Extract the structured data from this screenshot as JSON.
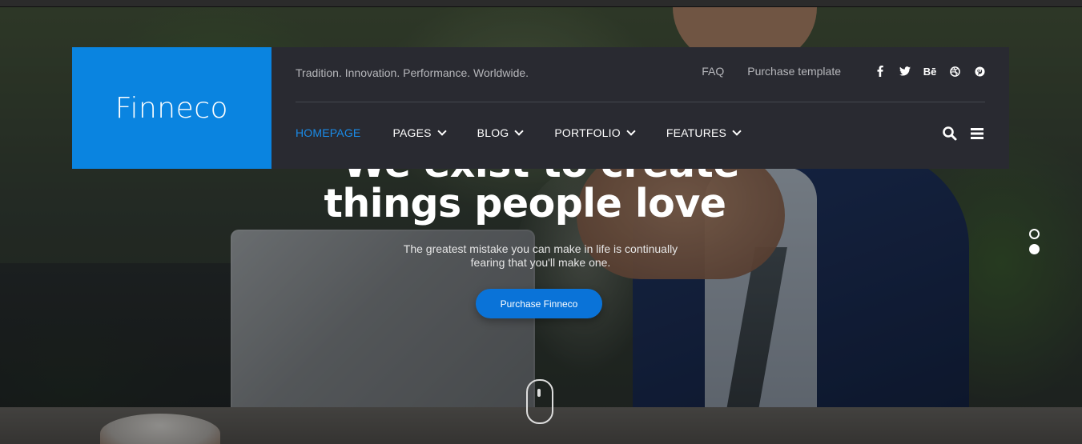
{
  "brand": {
    "name": "Finneco"
  },
  "header": {
    "tagline": "Tradition. Innovation. Performance. Worldwide.",
    "top_links": [
      {
        "label": "FAQ"
      },
      {
        "label": "Purchase template"
      }
    ],
    "social_icons": [
      "facebook-icon",
      "twitter-icon",
      "behance-icon",
      "dribbble-icon",
      "pinterest-icon"
    ],
    "social_glyphs": [
      "f",
      "t",
      "Bē",
      "⊕",
      "℗"
    ],
    "nav": [
      {
        "label": "HOMEPAGE",
        "active": true
      },
      {
        "label": "PAGES"
      },
      {
        "label": "BLOG"
      },
      {
        "label": "PORTFOLIO"
      },
      {
        "label": "FEATURES"
      }
    ],
    "tools": [
      "search-icon",
      "menu-icon"
    ]
  },
  "hero": {
    "headline_line1": "We exist to create",
    "headline_line2": "things people love",
    "subtext": "The greatest mistake you can make in life is continually fearing that you'll make one.",
    "cta_label": "Purchase Finneco"
  },
  "colors": {
    "accent": "#0a84e0",
    "nav_bg": "#292a31",
    "active_nav": "#1a8be8",
    "button": "#0a73d8"
  },
  "slider": {
    "slides": 2,
    "active_slide": 2
  }
}
